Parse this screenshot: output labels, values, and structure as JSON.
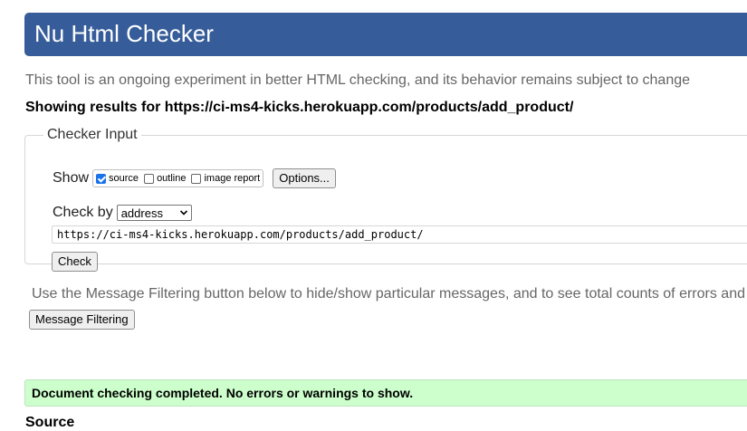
{
  "header": {
    "title": "Nu Html Checker"
  },
  "intro_text": "This tool is an ongoing experiment in better HTML checking, and its behavior remains subject to change",
  "showing_results": "Showing results for https://ci-ms4-kicks.herokuapp.com/products/add_product/",
  "checker_input": {
    "legend": "Checker Input",
    "show_label": "Show",
    "options": [
      {
        "label": "source",
        "checked": true
      },
      {
        "label": "outline",
        "checked": false
      },
      {
        "label": "image report",
        "checked": false
      }
    ],
    "options_button": "Options...",
    "check_by_label": "Check by",
    "check_by_value": "address",
    "url_value": "https://ci-ms4-kicks.herokuapp.com/products/add_product/",
    "check_button": "Check"
  },
  "filter": {
    "text": "Use the Message Filtering button below to hide/show particular messages, and to see total counts of errors and",
    "button": "Message Filtering"
  },
  "result_message": "Document checking completed. No errors or warnings to show.",
  "source_heading": "Source",
  "colors": {
    "header_bg": "#365d9a",
    "success_bg": "#ccffcc"
  }
}
